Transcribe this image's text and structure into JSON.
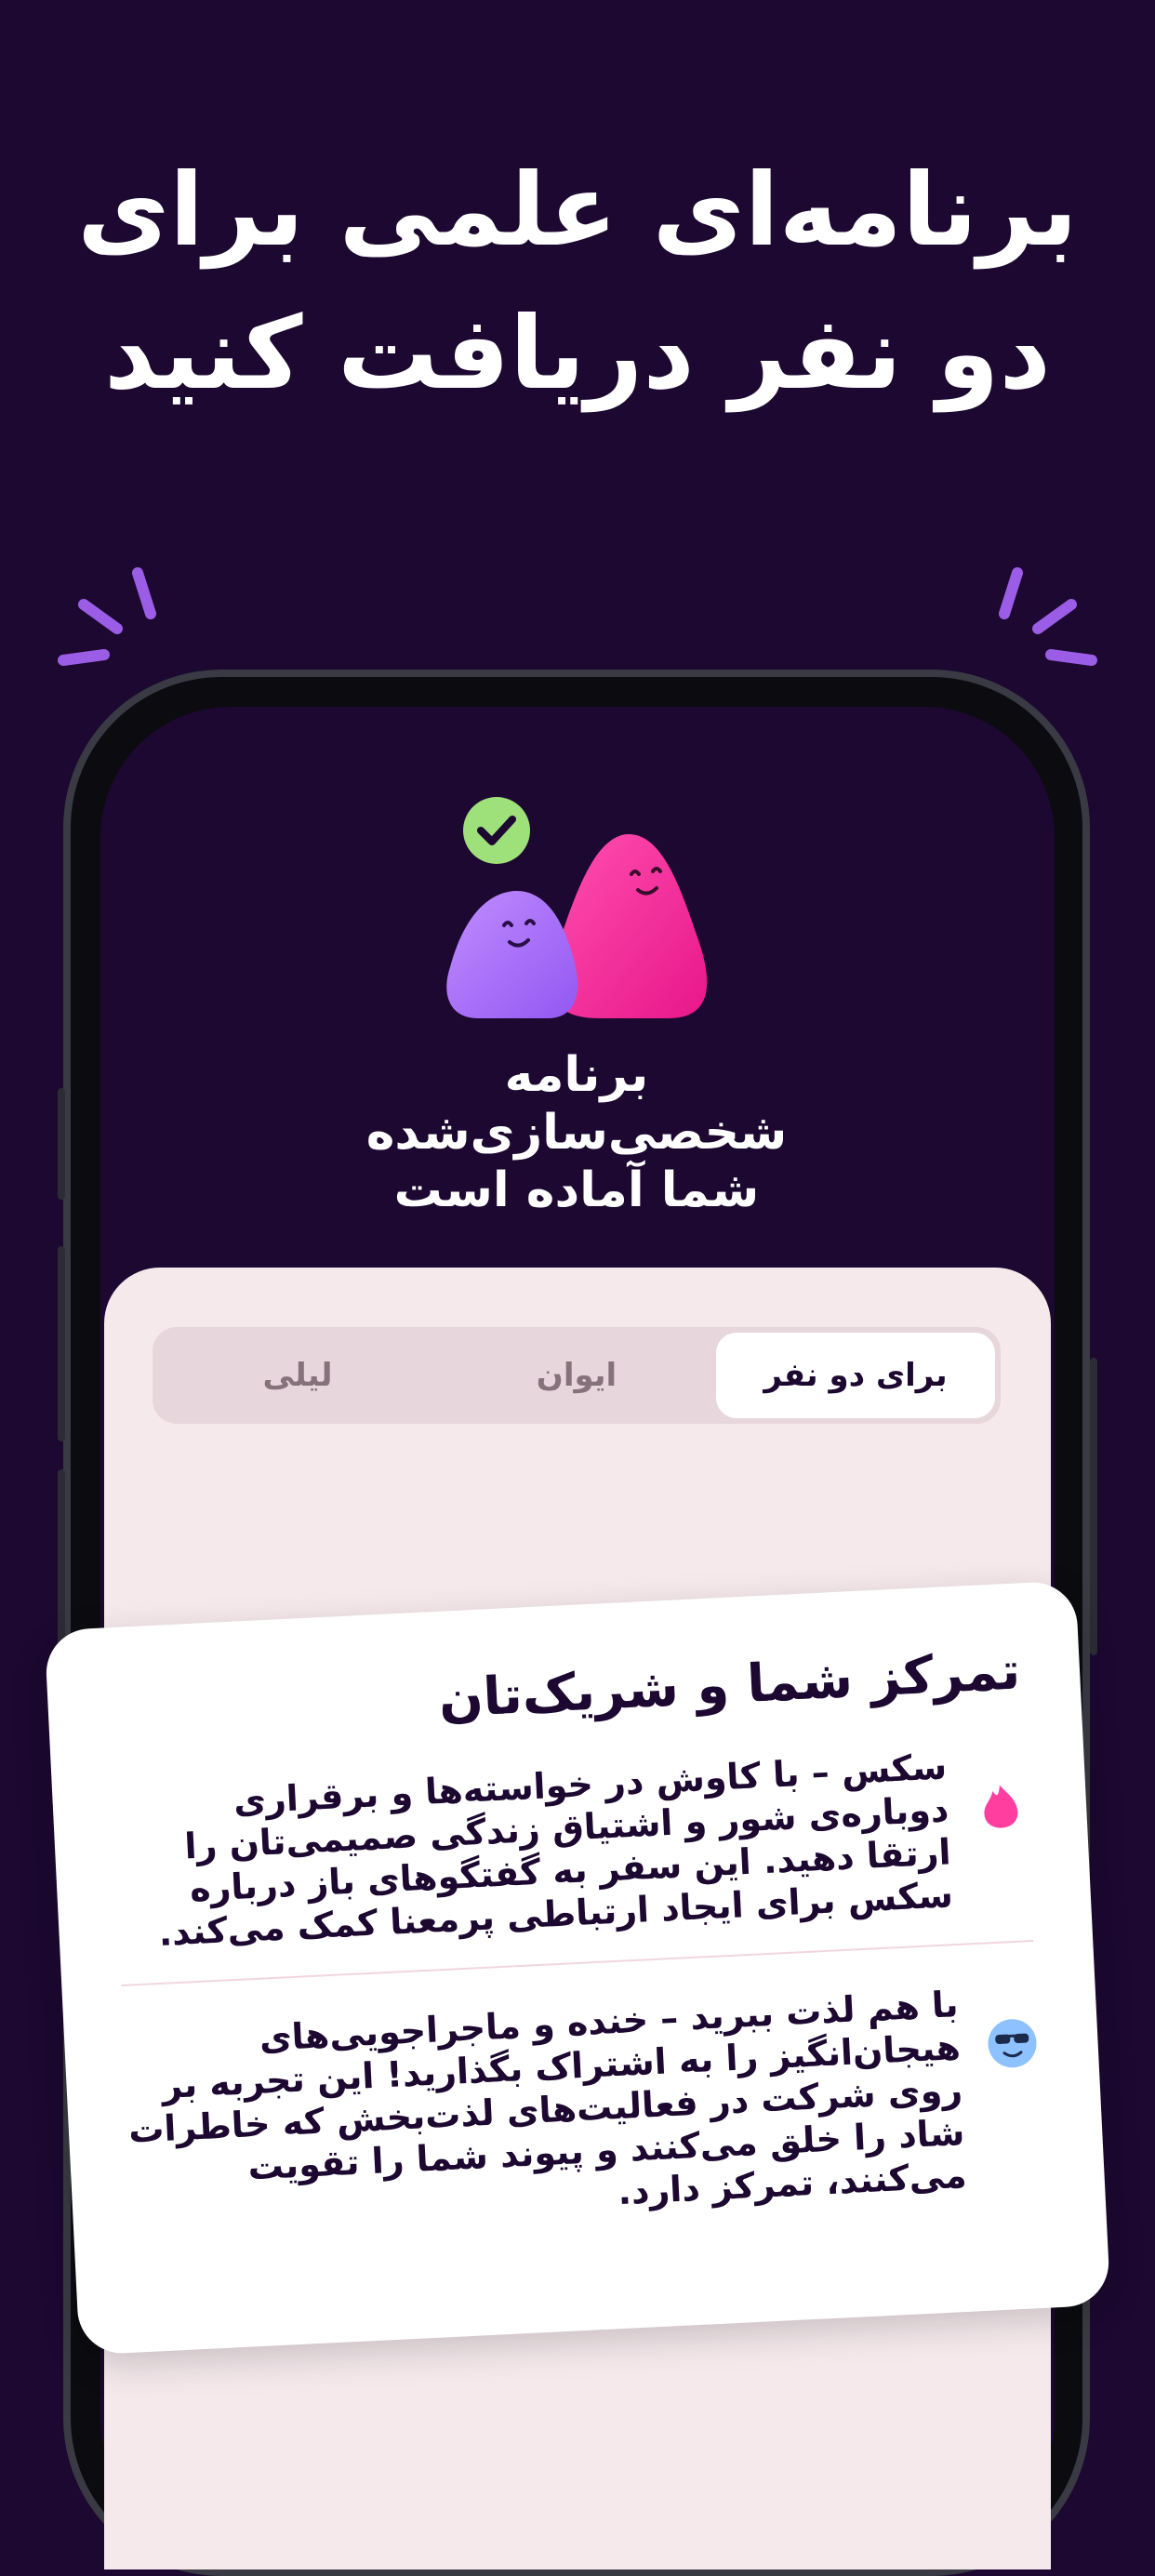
{
  "headline": "برنامه‌ای علمی برای دو نفر دریافت کنید",
  "ready_title": {
    "line1": "برنامه",
    "line2": "شخصی‌سازی‌شده",
    "line3": "شما آماده است"
  },
  "tabs": [
    {
      "label": "برای دو نفر",
      "active": true
    },
    {
      "label": "ایوان",
      "active": false
    },
    {
      "label": "لیلی",
      "active": false
    }
  ],
  "card": {
    "title": "تمرکز شما و شریک‌تان",
    "items": [
      {
        "icon": "flame-icon",
        "text": "سکس – با کاوش در خواسته‌ها و برقراری دوباره‌ی شور و اشتیاق زندگی صمیمی‌تان را ارتقا دهید. این سفر به گفتگوهای باز درباره سکس برای ایجاد ارتباطی پرمعنا کمک می‌کند."
      },
      {
        "icon": "cool-face-icon",
        "text": "با هم لذت ببرید – خنده و ماجراجویی‌های هیجان‌انگیز را به اشتراک بگذارید! این تجربه بر روی شرکت در فعالیت‌های لذت‌بخش که خاطرات شاد را خلق می‌کنند و پیوند شما را تقویت می‌کنند، تمرکز دارد."
      }
    ]
  },
  "colors": {
    "background": "#1c0830",
    "panel": "#f5e9ec",
    "accent_purple": "#9b5de5",
    "accent_pink": "#ff3ea0",
    "check_green": "#9ee07a"
  }
}
